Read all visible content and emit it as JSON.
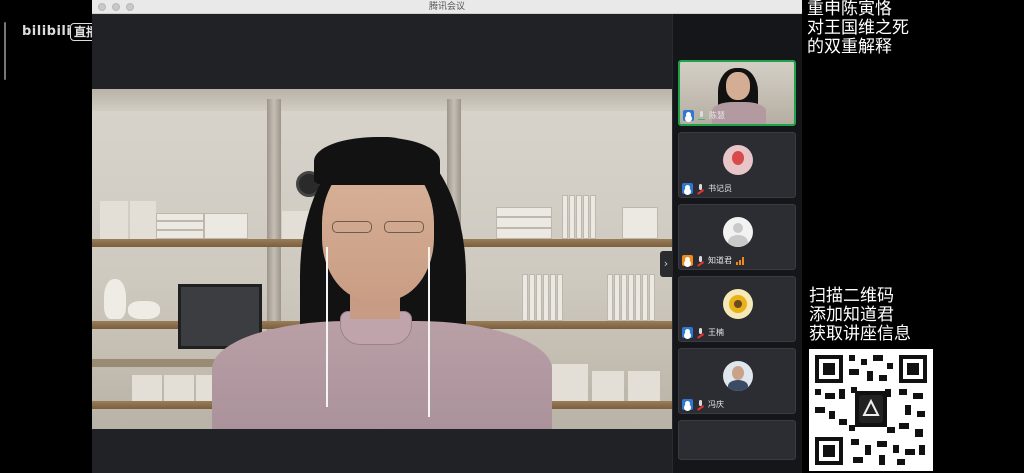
{
  "watermark": {
    "logo": "bilibili",
    "badge": "直播"
  },
  "window": {
    "title": "腾讯会议"
  },
  "participants": [
    {
      "name": "陈慧",
      "active": true,
      "mic": "on"
    },
    {
      "name": "书记员",
      "active": false,
      "mic": "muted"
    },
    {
      "name": "知道君",
      "active": false,
      "mic": "muted",
      "signal": 3
    },
    {
      "name": "王楠",
      "active": false,
      "mic": "muted"
    },
    {
      "name": "冯庆",
      "active": false,
      "mic": "muted"
    }
  ],
  "overlay": {
    "topic_line1": "重申陈寅恪",
    "topic_line2": "对王国维之死",
    "topic_line3": "的双重解释",
    "qr_line1": "扫描二维码",
    "qr_line2": "添加知道君",
    "qr_line3": "获取讲座信息"
  },
  "colors": {
    "active_border": "#1fa34a",
    "user_icon": "#2f78d4",
    "signal": "#f08a1c"
  }
}
